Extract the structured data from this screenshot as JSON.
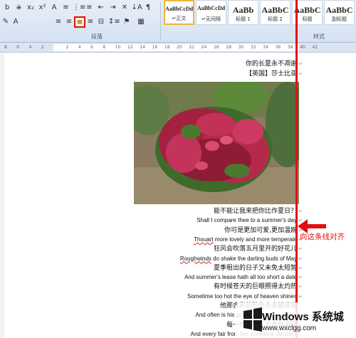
{
  "ribbon": {
    "row1_icons": [
      "bold-icon",
      "strikethrough-icon",
      "subscript-icon",
      "superscript-icon",
      "font-color-icon",
      "bullets-icon",
      "numbering-icon",
      "multilevel-list-icon",
      "decrease-indent-icon",
      "increase-indent-icon",
      "chinese-layout-icon",
      "sort-icon",
      "show-marks-icon"
    ],
    "row2_icons": [
      "highlight-icon",
      "font-color-a-icon",
      "align-left-icon",
      "align-center-icon",
      "align-right-icon",
      "justify-icon",
      "distributed-icon",
      "line-spacing-icon",
      "shading-icon",
      "borders-icon"
    ],
    "row1_glyphs": [
      "b",
      "a̶",
      "x₂",
      "x²",
      "A",
      "≡",
      "⋮≡",
      "≡",
      "⇤",
      "⇥",
      "✕",
      "↓A",
      "¶"
    ],
    "row2_glyphs": [
      "✎",
      "A",
      "≡",
      "≡",
      "≡",
      "≡",
      "⊟",
      "↕≡",
      "⚑",
      "▦"
    ],
    "paragraph_group_label": "段落",
    "styles_group_label": "样式",
    "styles": [
      {
        "sample": "AaBbCcDd",
        "name": "↵正文",
        "active": true
      },
      {
        "sample": "AaBbCcDd",
        "name": "↵无间隔",
        "active": false
      },
      {
        "sample": "AaBb",
        "name": "标题 1",
        "active": false
      },
      {
        "sample": "AaBbC",
        "name": "标题 2",
        "active": false
      },
      {
        "sample": "AaBbC",
        "name": "标题",
        "active": false
      },
      {
        "sample": "AaBbC",
        "name": "副标题",
        "active": false
      }
    ],
    "selected_button": "align-right-icon"
  },
  "ruler": {
    "ticks": [
      "8",
      "6",
      "4",
      "2",
      "",
      "2",
      "4",
      "6",
      "8",
      "10",
      "12",
      "14",
      "16",
      "18",
      "20",
      "22",
      "24",
      "26",
      "28",
      "30",
      "32",
      "34",
      "36",
      "38",
      "40",
      "42"
    ]
  },
  "document": {
    "lines_top": [
      {
        "text": "你的长夏永不凋谢",
        "lang": "cn"
      },
      {
        "text": "【英国】莎士比亚",
        "lang": "cn"
      }
    ],
    "lines_bottom": [
      {
        "text": "能不能让我来把你比作夏日？",
        "lang": "cn"
      },
      {
        "text": "Shall I compare thee to a summer's day",
        "lang": "en"
      },
      {
        "text": "你可是更加可爱,更加温婉",
        "lang": "cn"
      },
      {
        "text": "Thouart more lovely and more temperate",
        "lang": "en",
        "squiggle": "Thouart"
      },
      {
        "text": "狂风会吹落五月里开的好花儿",
        "lang": "cn"
      },
      {
        "text": "Roughwinds do shake the darling buds of May",
        "lang": "en",
        "squiggle": "Roughwinds"
      },
      {
        "text": "夏季租出的日子又未免太短暂",
        "lang": "cn"
      },
      {
        "text": "And summer's lease hath all too short a date",
        "lang": "en"
      },
      {
        "text": "有时候苍天的巨眼照得太灼热",
        "lang": "cn"
      },
      {
        "text": "Sometime too hot the eye of heaven shines",
        "lang": "en"
      },
      {
        "text": "他那金彩的脸色也会被遮暗",
        "lang": "cn"
      },
      {
        "text": "And often is his gold complexion dimm'd",
        "lang": "en"
      },
      {
        "text": "每一样美呀，总会有凋残",
        "lang": "cn"
      },
      {
        "text": "And every fair from fair sometime declines",
        "lang": "en"
      }
    ],
    "para_mark": "↵",
    "annotation": "向这条线对齐",
    "photo_alt": "flowering shrub with red blossoms"
  },
  "watermark": {
    "title": "Windows 系统城",
    "url": "www.wxclgg.com",
    "logo_icon": "windows-logo-icon"
  }
}
